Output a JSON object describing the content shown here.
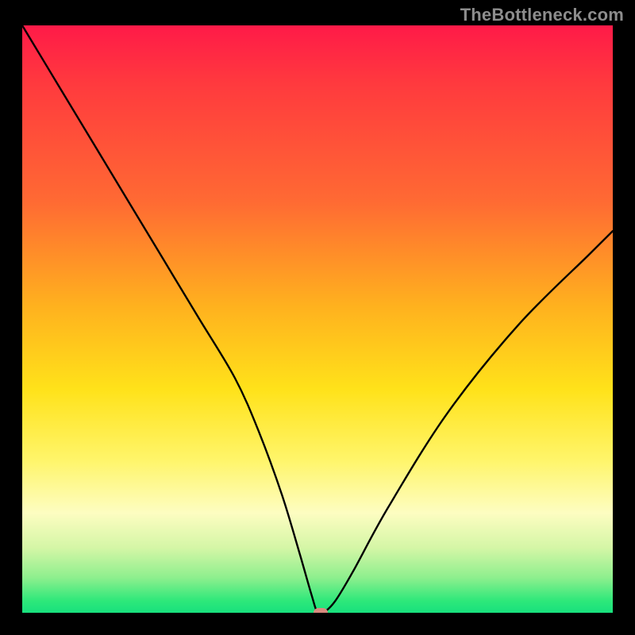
{
  "watermark": "TheBottleneck.com",
  "chart_data": {
    "type": "line",
    "title": "",
    "xlabel": "",
    "ylabel": "",
    "xlim": [
      0,
      100
    ],
    "ylim": [
      0,
      100
    ],
    "series": [
      {
        "name": "bottleneck-curve",
        "x": [
          0,
          6,
          12,
          18,
          24,
          30,
          36,
          40,
          44,
          47,
          49,
          50,
          51,
          53,
          56,
          62,
          72,
          84,
          96,
          100
        ],
        "y": [
          100,
          90,
          80,
          70,
          60,
          50,
          40,
          31,
          20,
          10,
          3,
          0,
          0,
          2,
          7,
          18,
          34,
          49,
          61,
          65
        ]
      }
    ],
    "marker": {
      "name": "min-point",
      "x": 50.5,
      "y": 0
    },
    "background": {
      "type": "vertical-gradient",
      "stops": [
        {
          "pos": 0.0,
          "color": "#ff1a48"
        },
        {
          "pos": 0.3,
          "color": "#ff6a33"
        },
        {
          "pos": 0.62,
          "color": "#ffe21a"
        },
        {
          "pos": 0.83,
          "color": "#fdfdc1"
        },
        {
          "pos": 0.94,
          "color": "#8eef8e"
        },
        {
          "pos": 1.0,
          "color": "#18e07d"
        }
      ]
    }
  }
}
